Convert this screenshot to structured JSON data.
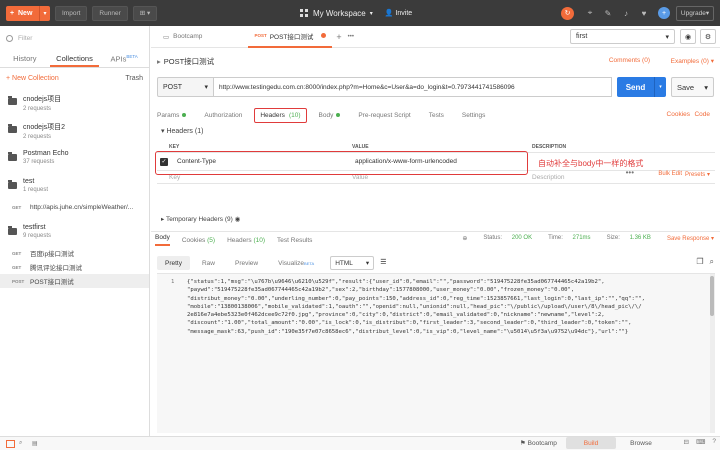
{
  "topbar": {
    "new_label": "New",
    "import_label": "Import",
    "runner_label": "Runner",
    "workspace_label": "My Workspace",
    "invite_label": "Invite",
    "upgrade_label": "Upgrade"
  },
  "sidebar": {
    "filter_placeholder": "Filter",
    "tabs": {
      "history": "History",
      "collections": "Collections",
      "apis": "APIs",
      "apis_badge": "BETA"
    },
    "new_collection": "+ New Collection",
    "trash": "Trash",
    "collections": [
      {
        "name": "cnodejs项目",
        "count": "2 requests"
      },
      {
        "name": "cnodejs项目2",
        "count": "2 requests"
      },
      {
        "name": "Postman Echo",
        "count": "37 requests"
      },
      {
        "name": "test",
        "count": "1 request"
      },
      {
        "name": "testfirst",
        "count": "9 requests"
      }
    ],
    "test_request": {
      "method": "GET",
      "name": "http://apis.juhe.cn/simpleWeather/..."
    },
    "testfirst_requests": [
      {
        "method": "GET",
        "name": "百度ip接口测试"
      },
      {
        "method": "GET",
        "name": "腾讯评论接口测试"
      },
      {
        "method": "POST",
        "name": "POST接口测试"
      }
    ]
  },
  "tabs": {
    "bootcamp": "Bootcamp",
    "active_method": "POST",
    "active_name": "POST接口测试",
    "x": "×",
    "plus": "+",
    "more": "•••"
  },
  "env": {
    "selected": "first"
  },
  "request": {
    "name": "POST接口测试",
    "comments": "Comments (0)",
    "examples": "Examples (0)",
    "method": "POST",
    "url": "http://www.testingedu.com.cn:8000/index.php?m=Home&c=User&a=do_login&t=0.7973441741586096",
    "send": "Send",
    "save": "Save"
  },
  "req_tabs": {
    "params": "Params",
    "authorization": "Authorization",
    "headers": "Headers",
    "headers_count": "(10)",
    "body": "Body",
    "prerequest": "Pre-request Script",
    "tests": "Tests",
    "settings": "Settings",
    "cookies": "Cookies",
    "code": "Code"
  },
  "headers": {
    "section": "Headers (1)",
    "col_key": "KEY",
    "col_value": "VALUE",
    "col_desc": "DESCRIPTION",
    "more": "•••",
    "bulk_edit": "Bulk Edit",
    "presets": "Presets",
    "row_key": "Content-Type",
    "row_value": "application/x-www-form-urlencoded",
    "new_key": "Key",
    "new_value": "Value",
    "new_desc": "Description",
    "temp": "Temporary Headers (9)"
  },
  "annotation": "自动补全与body中一样的格式",
  "response": {
    "tabs": {
      "body": "Body",
      "cookies": "Cookies",
      "cookies_count": "(5)",
      "headers": "Headers",
      "headers_count": "(10)",
      "tests": "Test Results"
    },
    "status_label": "Status:",
    "status": "200 OK",
    "time_label": "Time:",
    "time": "271ms",
    "size_label": "Size:",
    "size": "1.36 KB",
    "save_response": "Save Response",
    "views": {
      "pretty": "Pretty",
      "raw": "Raw",
      "preview": "Preview",
      "visualize": "Visualize",
      "visualize_badge": "BETA"
    },
    "format": "HTML",
    "line_number": "1",
    "body_text": "{\"status\":1,\"msg\":\"\\u767b\\u9646\\u6210\\u529f\",\"result\":{\"user_id\":0,\"email\":\"\",\"password\":\"519475228fe35ad067744465c42a19b2\",\n\"paywd\":\"519475228fe35ad067744465c42a19b2\",\"sex\":2,\"birthday\":1577808000,\"user_money\":\"0.00\",\"frozen_money\":\"0.00\",\n\"distribut_money\":\"0.00\",\"underling_number\":0,\"pay_points\":150,\"address_id\":0,\"reg_time\":1523857661,\"last_login\":0,\"last_ip\":\"\",\"qq\":\"\",\n\"mobile\":\"13800138006\",\"mobile_validated\":1,\"oauth\":\"\",\"openid\":null,\"unionid\":null,\"head_pic\":\"\\/public\\/upload\\/user\\/8\\/head_pic\\/\\/\n2e816e7a4ebe5323e0f462dcee9c72f0.jpg\",\"province\":0,\"city\":0,\"district\":0,\"email_validated\":0,\"nickname\":\"newname\",\"level\":2,\n\"discount\":\"1.00\",\"total_amount\":\"0.00\",\"is_lock\":0,\"is_distribut\":0,\"first_leader\":3,\"second_leader\":0,\"third_leader\":0,\"token\":\"\",\n\"message_mask\":63,\"push_id\":\"190e35f7e07c8658ec6\",\"distribut_level\":0,\"is_vip\":0,\"level_name\":\"\\u5014\\u5f3a\\u9752\\u94dc\"},\"url\":\"\"}"
  },
  "bottom": {
    "bootcamp": "Bootcamp",
    "build": "Build",
    "browse": "Browse"
  }
}
